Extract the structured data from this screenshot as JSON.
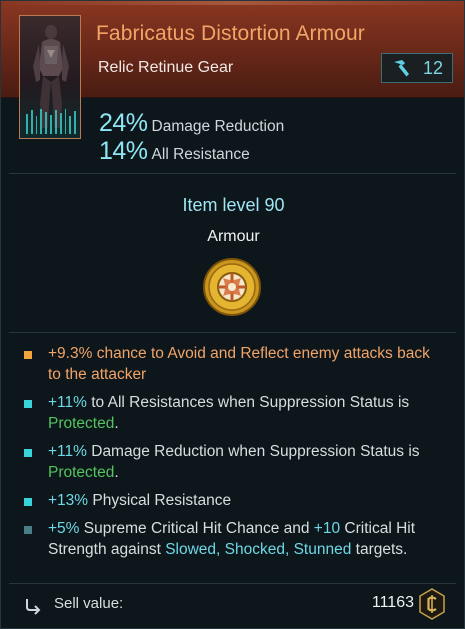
{
  "item": {
    "name": "Fabricatus Distortion Armour",
    "type": "Relic Retinue Gear",
    "requirement_value": "12",
    "requirement_icon": "hammer-icon",
    "name_color": "#f3a467"
  },
  "stats": [
    {
      "value": "24%",
      "label": "Damage Reduction"
    },
    {
      "value": "14%",
      "label": "All Resistance"
    }
  ],
  "item_level": "Item level 90",
  "slot": "Armour",
  "affixes": [
    {
      "bullet": "gold",
      "parts": [
        {
          "text": "+9.3%",
          "color": "orange"
        },
        {
          "text": " chance to Avoid and Reflect enemy attacks back to the attacker",
          "color": "orange"
        }
      ]
    },
    {
      "bullet": "teal",
      "parts": [
        {
          "text": "+11%",
          "color": "cyan"
        },
        {
          "text": " to All Resistances when Suppression Status is ",
          "color": "plain"
        },
        {
          "text": "Protected",
          "color": "green"
        },
        {
          "text": ".",
          "color": "plain"
        }
      ]
    },
    {
      "bullet": "teal",
      "parts": [
        {
          "text": "+11%",
          "color": "cyan"
        },
        {
          "text": " Damage Reduction when Suppression Status is ",
          "color": "plain"
        },
        {
          "text": "Protected",
          "color": "green"
        },
        {
          "text": ".",
          "color": "plain"
        }
      ]
    },
    {
      "bullet": "teal",
      "parts": [
        {
          "text": "+13%",
          "color": "cyan"
        },
        {
          "text": " Physical Resistance",
          "color": "plain"
        }
      ]
    },
    {
      "bullet": "dim",
      "parts": [
        {
          "text": "+5%",
          "color": "cyan"
        },
        {
          "text": " Supreme Critical Hit Chance and ",
          "color": "plain"
        },
        {
          "text": "+10",
          "color": "cyan"
        },
        {
          "text": " Critical Hit Strength against ",
          "color": "plain"
        },
        {
          "text": "Slowed, Shocked, Stunned",
          "color": "cyan"
        },
        {
          "text": " targets.",
          "color": "plain"
        }
      ]
    }
  ],
  "footer": {
    "sell_label": "Sell value:",
    "sell_value": "11163",
    "coin_icon": "credits-coin-icon",
    "sell_icon": "sell-arrow-icon"
  },
  "colors": {
    "header_bg": "#6e2a1a",
    "accent_cyan": "#6fd8e6",
    "accent_orange": "#f2a467",
    "status_green": "#53c45f"
  }
}
